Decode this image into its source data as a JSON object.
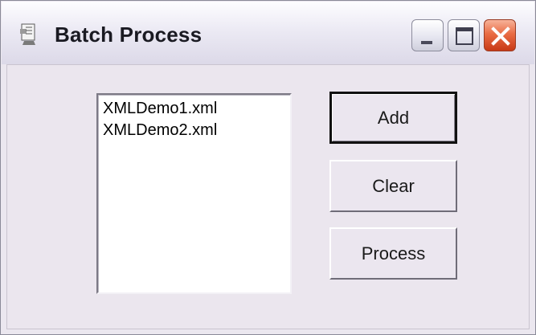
{
  "window": {
    "title": "Batch Process",
    "controls": {
      "minimize_icon": "minimize-icon",
      "maximize_icon": "maximize-icon",
      "close_icon": "close-icon"
    }
  },
  "files": {
    "items": [
      "XMLDemo1.xml",
      "XMLDemo2.xml"
    ]
  },
  "buttons": {
    "add": "Add",
    "clear": "Clear",
    "process": "Process"
  },
  "colors": {
    "close_button": "#d9532e",
    "client_background": "#ebe6ee"
  }
}
